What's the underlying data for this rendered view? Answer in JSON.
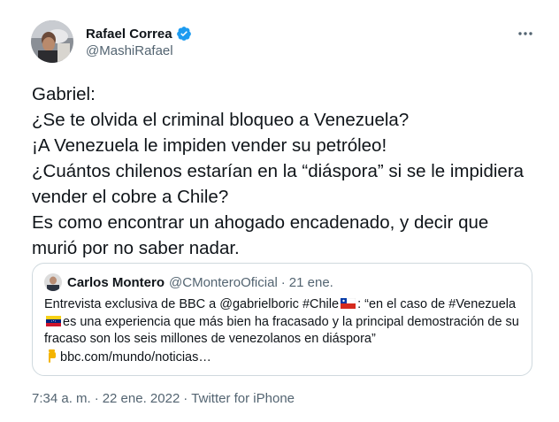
{
  "author": {
    "name": "Rafael Correa",
    "handle": "@MashiRafael",
    "verified": true
  },
  "tweet_text": "Gabriel:\n¿Se te olvida el criminal bloqueo a Venezuela?\n¡A Venezuela le impiden vender su petróleo!\n¿Cuántos chilenos estarían en la “diáspora” si se le impidiera vender el cobre a Chile?\nEs como encontrar un ahogado encadenado, y decir que murió por no saber nadar.",
  "quote": {
    "name": "Carlos Montero",
    "handle": "@CMonteroOficial",
    "separator": "·",
    "date": "21 ene.",
    "text_part1": "Entrevista exclusiva de BBC a @gabrielboric #Chile",
    "text_part2": ":  “en el caso de #Venezuela",
    "text_part3": "es una experiencia que más bien ha fracasado y la principal demostración de su fracaso son los seis millones de venezolanos en diáspora”",
    "link": "bbc.com/mundo/noticias…"
  },
  "meta": {
    "time": "7:34 a. m.",
    "separator1": "·",
    "date": "22 ene. 2022",
    "separator2": "·",
    "source": "Twitter for iPhone"
  },
  "icons": {
    "verified": "verified-badge-icon",
    "more": "more-options-icon",
    "chile_flag": "chile-flag-icon",
    "venezuela_flag": "venezuela-flag-icon",
    "pointing_down": "pointing-down-emoji-icon"
  },
  "colors": {
    "text_primary": "#0f1419",
    "text_secondary": "#536471",
    "verified_blue": "#1d9bf0",
    "border": "#cfd9de"
  }
}
